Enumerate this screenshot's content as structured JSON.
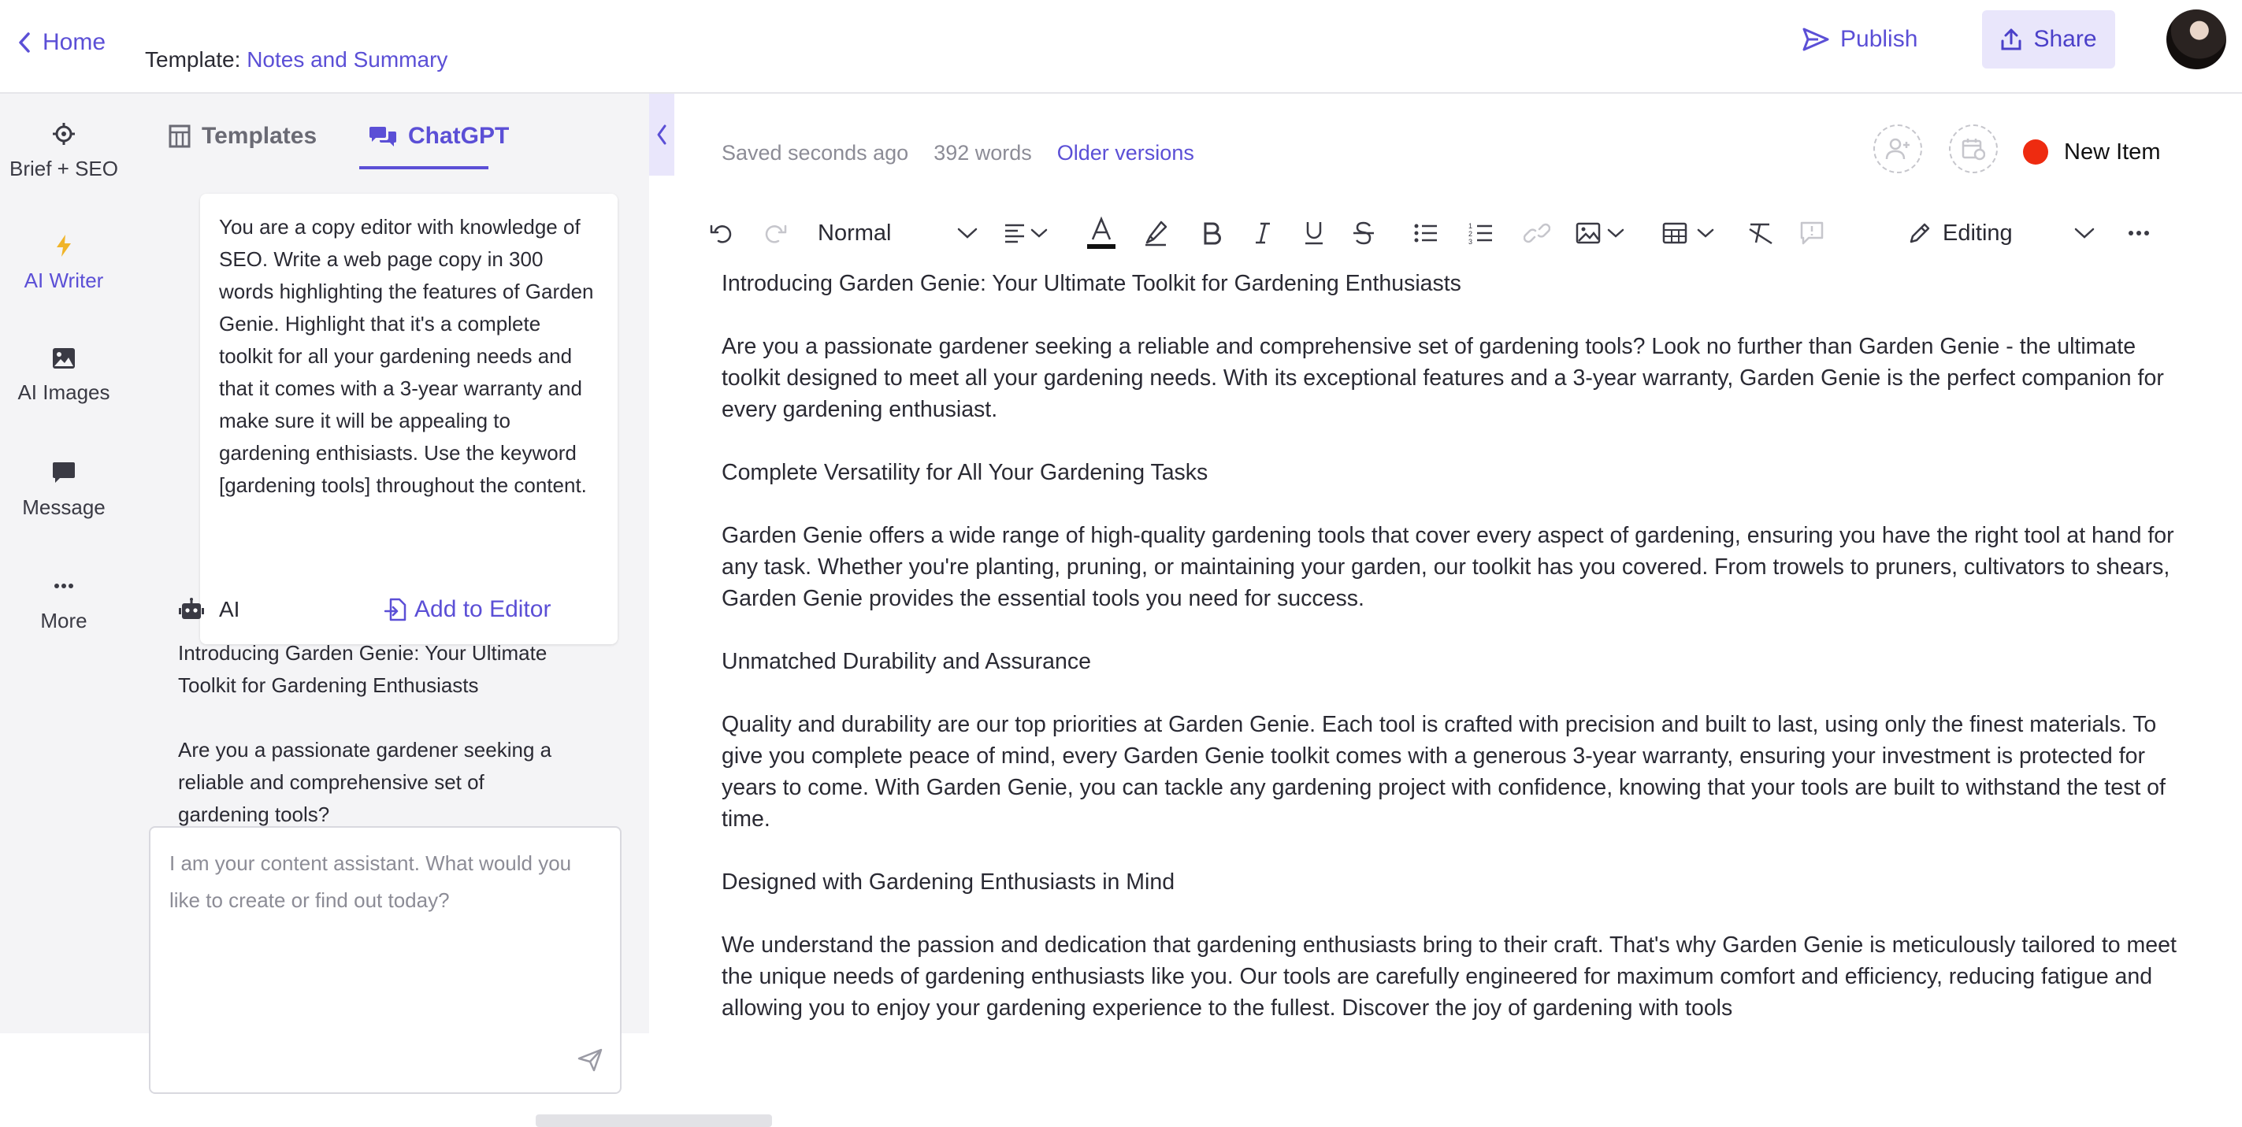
{
  "topbar": {
    "home_label": "Home",
    "template_prefix": "Template:",
    "template_name": "Notes and Summary",
    "publish_label": "Publish",
    "share_label": "Share"
  },
  "rail": {
    "items": [
      {
        "label": "Brief + SEO",
        "icon": "crosshair-icon"
      },
      {
        "label": "AI Writer",
        "icon": "lightning-icon"
      },
      {
        "label": "AI Images",
        "icon": "image-icon"
      },
      {
        "label": "Message",
        "icon": "message-icon"
      },
      {
        "label": "More",
        "icon": "more-dots-icon"
      }
    ],
    "active": "AI Writer"
  },
  "panel": {
    "tabs": [
      {
        "label": "Templates",
        "icon": "templates-grid-icon"
      },
      {
        "label": "ChatGPT",
        "icon": "chat-bubbles-icon"
      }
    ],
    "active_tab": "ChatGPT",
    "prompt": "You are a copy editor with knowledge of SEO. Write a web page copy in 300 words highlighting the features of Garden Genie. Highlight that it's a complete toolkit for all your gardening needs and that it comes with a 3-year warranty and make sure it will be appealing to gardening enthisiasts. Use the keyword [gardening tools] throughout the content.",
    "ai_label": "AI",
    "add_to_editor_label": "Add to Editor",
    "ai_response": [
      "Introducing Garden Genie: Your Ultimate Toolkit for Gardening Enthusiasts",
      "Are you a passionate gardener seeking a reliable and comprehensive set of gardening tools?"
    ],
    "input_placeholder": "I am your content assistant. What would you like to create or find out today?"
  },
  "editor": {
    "status_saved": "Saved seconds ago",
    "word_count": "392 words",
    "older_versions_label": "Older versions",
    "new_item_label": "New Item",
    "new_item_color": "#ee2b10",
    "accent_color": "#5b4fd6",
    "toolbar": {
      "style_value": "Normal",
      "mode_value": "Editing",
      "icons": [
        "undo-icon",
        "redo-icon",
        "align-icon",
        "font-color-icon",
        "highlight-icon",
        "bold-icon",
        "italic-icon",
        "underline-icon",
        "strikethrough-icon",
        "bullet-list-icon",
        "numbered-list-icon",
        "link-icon",
        "image-icon",
        "table-icon",
        "clear-format-icon",
        "comment-icon",
        "pencil-icon",
        "more-icon"
      ]
    },
    "paragraphs": [
      "Introducing Garden Genie: Your Ultimate Toolkit for Gardening Enthusiasts",
      "Are you a passionate gardener seeking a reliable and comprehensive set of gardening tools? Look no further than Garden Genie - the ultimate toolkit designed to meet all your gardening needs. With its exceptional features and a 3-year warranty, Garden Genie is the perfect companion for every gardening enthusiast.",
      "Complete Versatility for All Your Gardening Tasks",
      "Garden Genie offers a wide range of high-quality gardening tools that cover every aspect of gardening, ensuring you have the right tool at hand for any task. Whether you're planting, pruning, or maintaining your garden, our toolkit has you covered. From trowels to pruners, cultivators to shears, Garden Genie provides the essential tools you need for success.",
      "Unmatched Durability and Assurance",
      "Quality and durability are our top priorities at Garden Genie. Each tool is crafted with precision and built to last, using only the finest materials. To give you complete peace of mind, every Garden Genie toolkit comes with a generous 3-year warranty, ensuring your investment is protected for years to come. With Garden Genie, you can tackle any gardening project with confidence, knowing that your tools are built to withstand the test of time.",
      "Designed with Gardening Enthusiasts in Mind",
      "We understand the passion and dedication that gardening enthusiasts bring to their craft. That's why Garden Genie is meticulously tailored to meet the unique needs of gardening enthusiasts like you. Our tools are carefully engineered for maximum comfort and efficiency, reducing fatigue and allowing you to enjoy your gardening experience to the fullest. Discover the joy of gardening with tools"
    ]
  }
}
